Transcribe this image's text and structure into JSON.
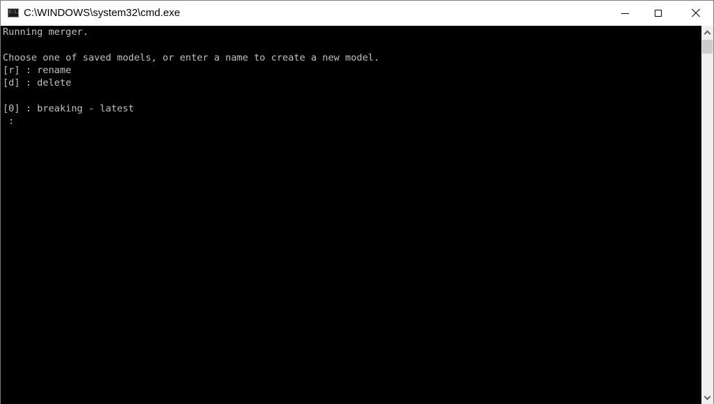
{
  "window": {
    "title": "C:\\WINDOWS\\system32\\cmd.exe",
    "app_icon_text": "C:\\."
  },
  "console": {
    "lines": [
      "Running merger.",
      "",
      "Choose one of saved models, or enter a name to create a new model.",
      "[r] : rename",
      "[d] : delete",
      "",
      "[0] : breaking - latest",
      " :"
    ]
  },
  "colors": {
    "console_bg": "#000000",
    "console_text": "#c0c0c0",
    "titlebar_bg": "#ffffff",
    "scrollbar_bg": "#f0f0f0"
  }
}
